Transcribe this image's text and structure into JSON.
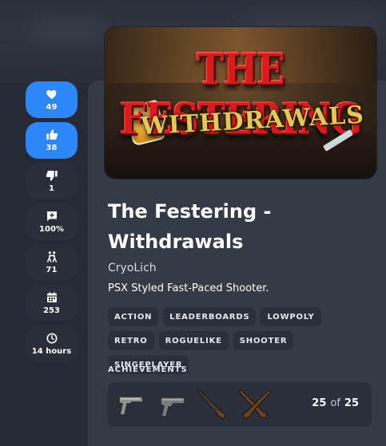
{
  "sidebar": {
    "buttons": [
      {
        "name": "favorite-button",
        "icon": "heart-icon",
        "value": "49",
        "active": true
      },
      {
        "name": "like-button",
        "icon": "thumbs-up-icon",
        "value": "38",
        "active": true
      },
      {
        "name": "dislike-button",
        "icon": "thumbs-down-icon",
        "value": "1",
        "active": false
      },
      {
        "name": "rating-button",
        "icon": "comment-plus-icon",
        "value": "100%",
        "active": false
      },
      {
        "name": "players-button",
        "icon": "players-icon",
        "value": "71",
        "active": false
      },
      {
        "name": "date-button",
        "icon": "calendar-icon",
        "value": "253",
        "active": false
      },
      {
        "name": "playtime-button",
        "icon": "clock-icon",
        "value": "14 hours",
        "active": false
      }
    ]
  },
  "cover": {
    "title_line1": "THE FESTERING",
    "title_line2": "WITHDRAWALS"
  },
  "game": {
    "title": "The Festering - Withdrawals",
    "developer": "CryoLich",
    "tagline": "PSX Styled Fast-Paced Shooter.",
    "tags": [
      "ACTION",
      "LEADERBOARDS",
      "LOWPOLY",
      "RETRO",
      "ROGUELIKE",
      "SHOOTER",
      "SINGEPLAYER"
    ]
  },
  "achievements": {
    "label": "ACHIEVEMENTS",
    "unlocked": "25",
    "of": "of",
    "total": "25",
    "icons": [
      "pistol-icon",
      "handgun-icon",
      "rifle-icon",
      "crossed-rifles-icon"
    ]
  },
  "colors": {
    "accent": "#2f86f6",
    "background": "#262a36",
    "panel": "#353a47",
    "title_red": "#d81c1c",
    "title_gold": "#e2c85a"
  }
}
